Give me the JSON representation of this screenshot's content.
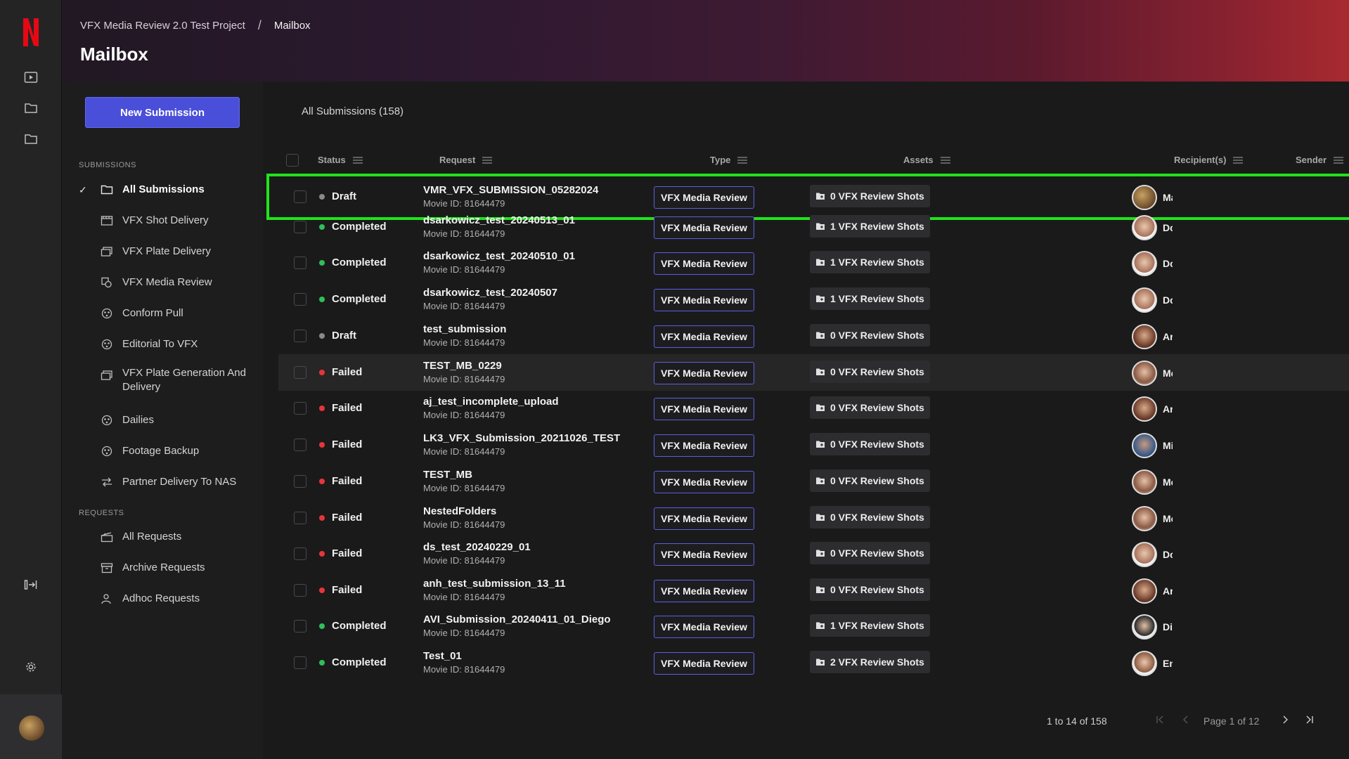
{
  "header": {
    "breadcrumb": [
      "VFX Media Review 2.0 Test Project",
      "Mailbox"
    ],
    "title": "Mailbox"
  },
  "sidebar": {
    "new_button": "New Submission",
    "submissions_label": "SUBMISSIONS",
    "submissions": [
      {
        "label": "All Submissions",
        "icon": "folder-icon",
        "active": true
      },
      {
        "label": "VFX Shot Delivery",
        "icon": "film-icon"
      },
      {
        "label": "VFX Plate Delivery",
        "icon": "plate-icon"
      },
      {
        "label": "VFX Media Review",
        "icon": "media-review-icon"
      },
      {
        "label": "Conform Pull",
        "icon": "reel-icon"
      },
      {
        "label": "Editorial To VFX",
        "icon": "reel-icon"
      },
      {
        "label": "VFX Plate Generation And Delivery",
        "icon": "plate-icon"
      },
      {
        "label": "Dailies",
        "icon": "reel-icon"
      },
      {
        "label": "Footage Backup",
        "icon": "reel-icon"
      },
      {
        "label": "Partner Delivery To NAS",
        "icon": "transfer-icon"
      }
    ],
    "requests_label": "REQUESTS",
    "requests": [
      {
        "label": "All Requests",
        "icon": "clapper-icon"
      },
      {
        "label": "Archive Requests",
        "icon": "archive-icon"
      },
      {
        "label": "Adhoc Requests",
        "icon": "person-icon"
      }
    ]
  },
  "main": {
    "tab": "All Submissions (158)",
    "columns": {
      "status": "Status",
      "request": "Request",
      "type": "Type",
      "assets": "Assets",
      "recipients": "Recipient(s)",
      "sender": "Sender"
    },
    "rows": [
      {
        "status": "Draft",
        "name": "VMR_VFX_SUBMISSION_05282024",
        "movie": "Movie ID: 81644479",
        "type": "VFX Media Review",
        "assets": "0 VFX Review Shots",
        "sender": "Ma"
      },
      {
        "status": "Completed",
        "name": "dsarkowicz_test_20240513_01",
        "movie": "Movie ID: 81644479",
        "type": "VFX Media Review",
        "assets": "1 VFX Review Shots",
        "sender": "Dc"
      },
      {
        "status": "Completed",
        "name": "dsarkowicz_test_20240510_01",
        "movie": "Movie ID: 81644479",
        "type": "VFX Media Review",
        "assets": "1 VFX Review Shots",
        "sender": "Dc"
      },
      {
        "status": "Completed",
        "name": "dsarkowicz_test_20240507",
        "movie": "Movie ID: 81644479",
        "type": "VFX Media Review",
        "assets": "1 VFX Review Shots",
        "sender": "Dc"
      },
      {
        "status": "Draft",
        "name": "test_submission",
        "movie": "Movie ID: 81644479",
        "type": "VFX Media Review",
        "assets": "0 VFX Review Shots",
        "sender": "Ar"
      },
      {
        "status": "Failed",
        "name": "TEST_MB_0229",
        "movie": "Movie ID: 81644479",
        "type": "VFX Media Review",
        "assets": "0 VFX Review Shots",
        "sender": "Me"
      },
      {
        "status": "Failed",
        "name": "aj_test_incomplete_upload",
        "movie": "Movie ID: 81644479",
        "type": "VFX Media Review",
        "assets": "0 VFX Review Shots",
        "sender": "Ar"
      },
      {
        "status": "Failed",
        "name": "LK3_VFX_Submission_20211026_TEST",
        "movie": "Movie ID: 81644479",
        "type": "VFX Media Review",
        "assets": "0 VFX Review Shots",
        "sender": "Mi"
      },
      {
        "status": "Failed",
        "name": "TEST_MB",
        "movie": "Movie ID: 81644479",
        "type": "VFX Media Review",
        "assets": "0 VFX Review Shots",
        "sender": "Me"
      },
      {
        "status": "Failed",
        "name": "NestedFolders",
        "movie": "Movie ID: 81644479",
        "type": "VFX Media Review",
        "assets": "0 VFX Review Shots",
        "sender": "Me"
      },
      {
        "status": "Failed",
        "name": "ds_test_20240229_01",
        "movie": "Movie ID: 81644479",
        "type": "VFX Media Review",
        "assets": "0 VFX Review Shots",
        "sender": "Dc"
      },
      {
        "status": "Failed",
        "name": "anh_test_submission_13_11",
        "movie": "Movie ID: 81644479",
        "type": "VFX Media Review",
        "assets": "0 VFX Review Shots",
        "sender": "Ar"
      },
      {
        "status": "Completed",
        "name": "AVI_Submission_20240411_01_Diego",
        "movie": "Movie ID: 81644479",
        "type": "VFX Media Review",
        "assets": "1 VFX Review Shots",
        "sender": "Di"
      },
      {
        "status": "Completed",
        "name": "Test_01",
        "movie": "Movie ID: 81644479",
        "type": "VFX Media Review",
        "assets": "2 VFX Review Shots",
        "sender": "En"
      }
    ],
    "pagination": {
      "range": "1 to 14 of 158",
      "page": "Page 1 of 12"
    }
  },
  "colors": {
    "accent": "#4a4fd9",
    "completed": "#2fbf5a",
    "failed": "#e8343a",
    "draft": "#8a8a8a",
    "selection": "#22e31a"
  }
}
